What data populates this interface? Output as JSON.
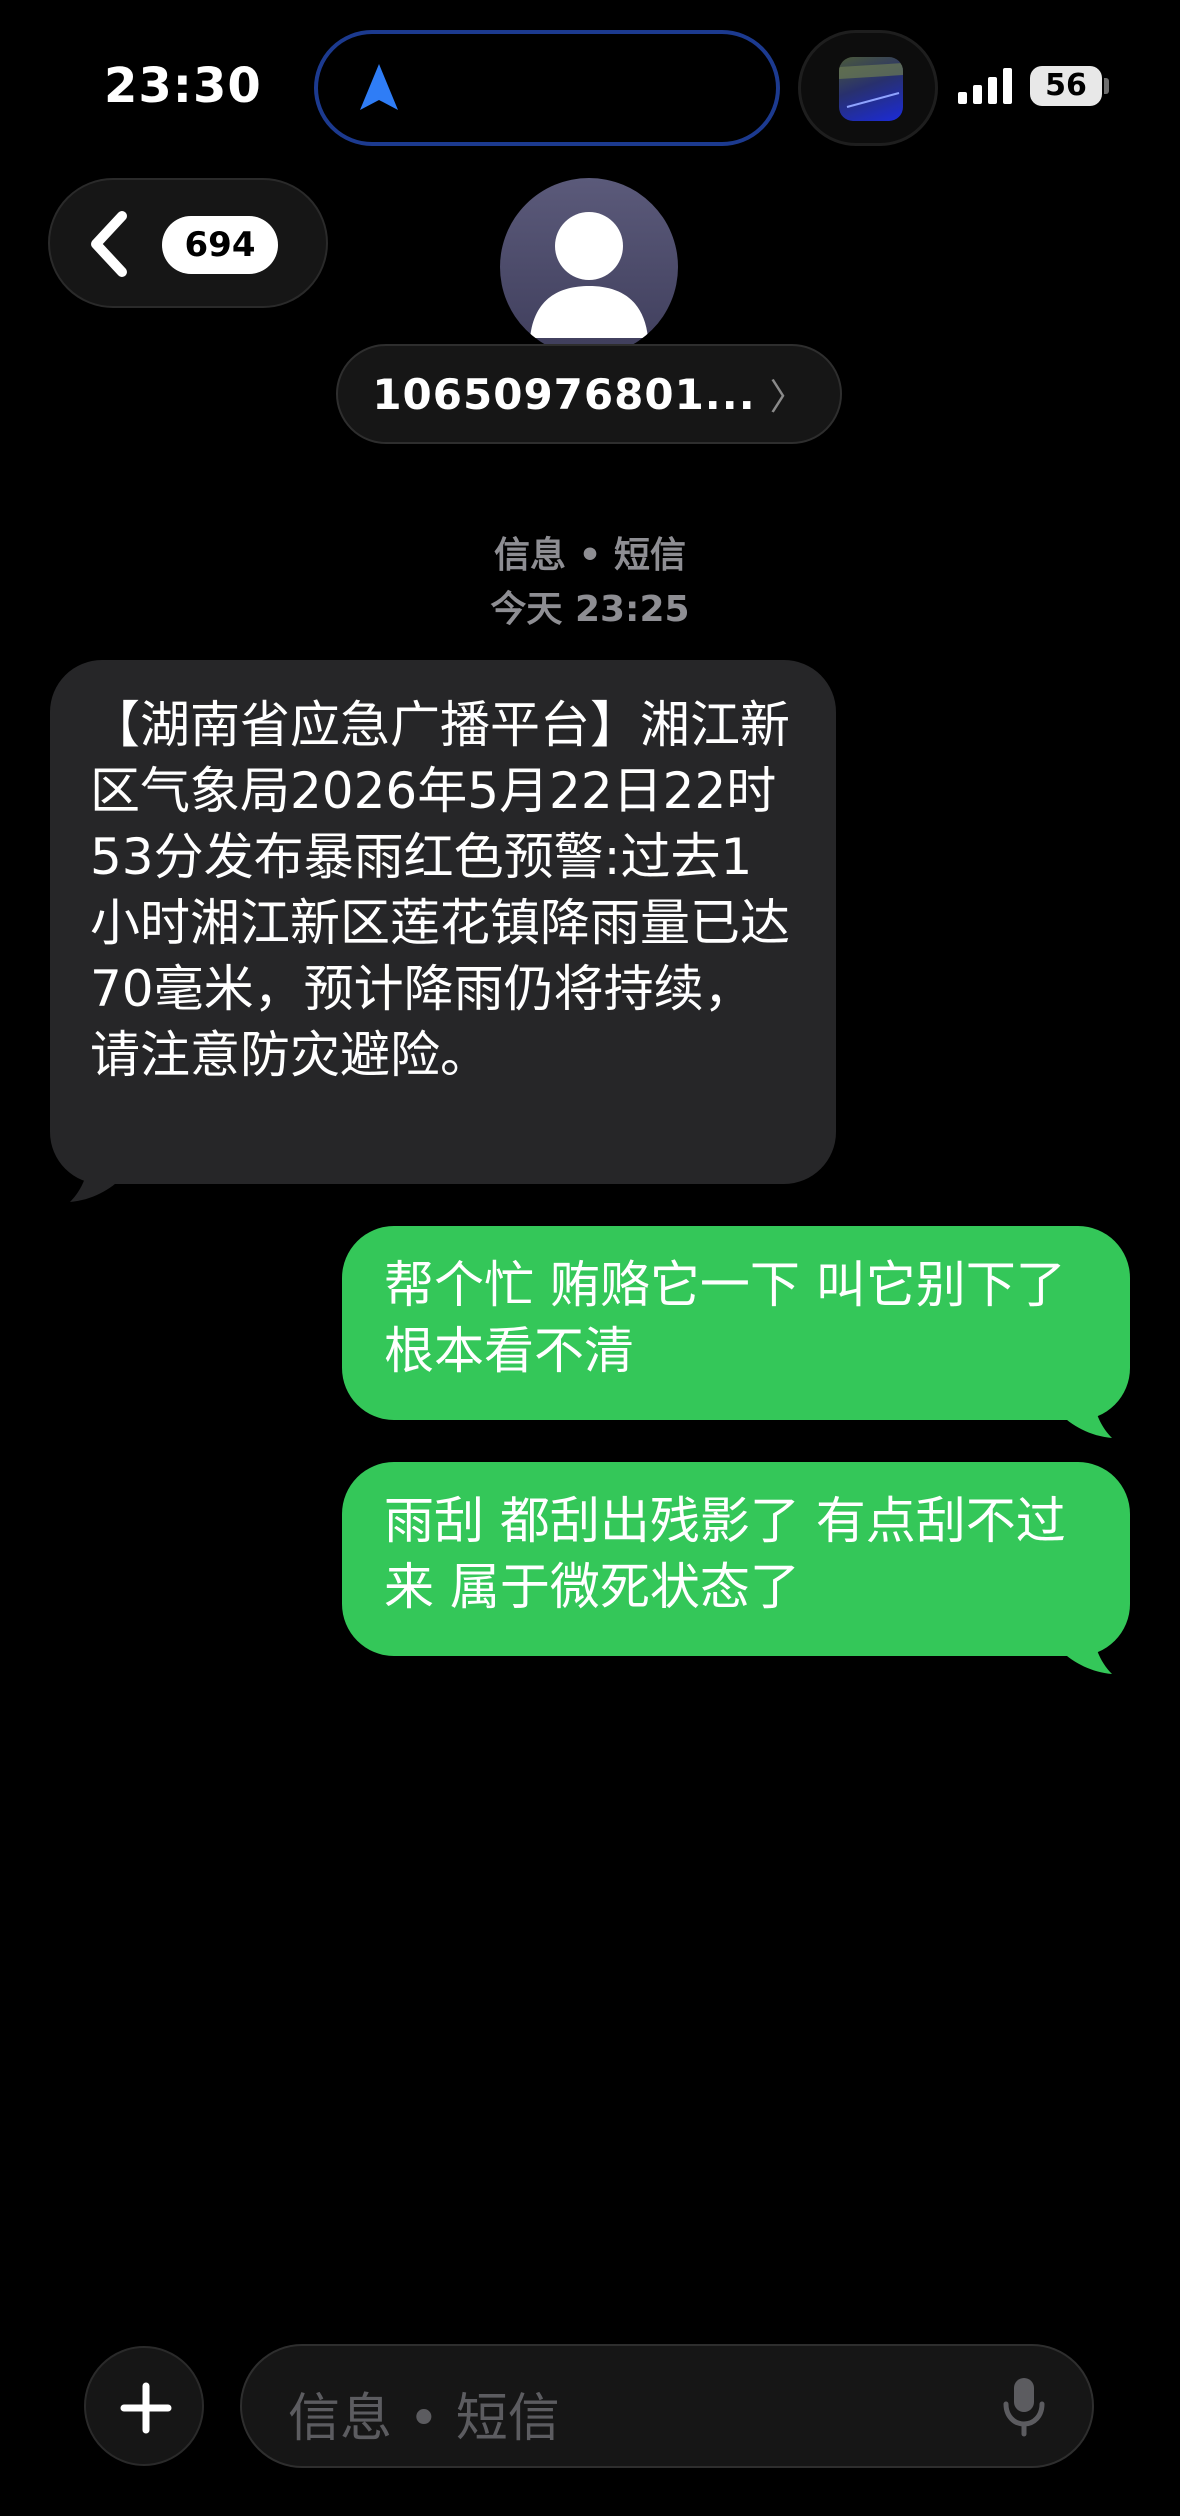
{
  "status_bar": {
    "time": "23:30",
    "battery": "56",
    "signal_bars": 4
  },
  "header": {
    "back_badge": "694",
    "contact": "10650976801...",
    "contact_arrow": "〉"
  },
  "thread": {
    "service_label": "信息 • 短信",
    "timestamp": "今天 23:25"
  },
  "messages": [
    {
      "direction": "incoming",
      "text": "【湖南省应急广播平台】湘江新区气象局2026年5月22日22时53分发布暴雨红色预警:过去1小时湘江新区莲花镇降雨量已达70毫米，预计降雨仍将持续，请注意防灾避险。"
    },
    {
      "direction": "outgoing",
      "text": "帮个忙 贿赂它一下 叫它别下了 根本看不清"
    },
    {
      "direction": "outgoing",
      "text": "雨刮 都刮出残影了 有点刮不过来 属于微死状态了"
    }
  ],
  "input_bar": {
    "placeholder": "信息 • 短信"
  },
  "colors": {
    "background": "#000000",
    "incoming_bubble": "#262628",
    "outgoing_bubble": "#34c759",
    "meta_text": "#8e8e93",
    "nav_arrow": "#2f7df6"
  },
  "icons": {
    "back": "chevron-left-icon",
    "navigation": "location-arrow-icon",
    "avatar": "person-icon",
    "add": "plus-icon",
    "dictation": "microphone-icon"
  }
}
